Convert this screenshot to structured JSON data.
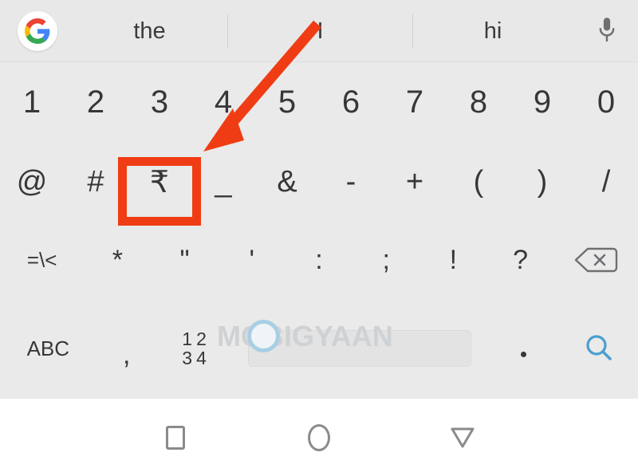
{
  "app": {
    "name": "Google Keyboard (Gboard) - Symbols Layout",
    "watermark": "MOBIGYAAN"
  },
  "suggestion_bar": {
    "logo_icon": "google-g-icon",
    "mic_icon": "microphone-icon",
    "suggestions": [
      {
        "id": "sugg-0",
        "label": "the"
      },
      {
        "id": "sugg-1",
        "label": "I"
      },
      {
        "id": "sugg-2",
        "label": "hi"
      }
    ]
  },
  "keyboard": {
    "number_row": [
      "1",
      "2",
      "3",
      "4",
      "5",
      "6",
      "7",
      "8",
      "9",
      "0"
    ],
    "symbol_row": [
      "@",
      "#",
      "₹",
      "_",
      "&",
      "-",
      "+",
      "(",
      ")",
      "/"
    ],
    "punctuation_row": {
      "mode_key": "=\\<",
      "keys": [
        "*",
        "\"",
        "'",
        ":",
        ";",
        "!",
        "?"
      ],
      "backspace_icon": "backspace-icon"
    },
    "bottom_row": {
      "abc_key": "ABC",
      "comma_key": ",",
      "numeric_grid": [
        "1",
        "2",
        "3",
        "4"
      ],
      "space_key": "",
      "period_key": ".",
      "search_icon": "search-icon"
    }
  },
  "annotation": {
    "highlight_key": "₹",
    "highlight_color": "#f03c14",
    "arrow_color": "#f03c14"
  },
  "nav_bar": {
    "recents_icon": "square-recents-icon",
    "home_icon": "circle-home-icon",
    "back_icon": "triangle-back-icon"
  },
  "colors": {
    "keyboard_bg": "#eaeaea",
    "suggestion_bg": "#e8e8e8",
    "key_text": "#37373a",
    "search_blue": "#4a9fd0",
    "nav_icon": "#8b8b8f",
    "watermark_gray": "#cfd2d4"
  }
}
